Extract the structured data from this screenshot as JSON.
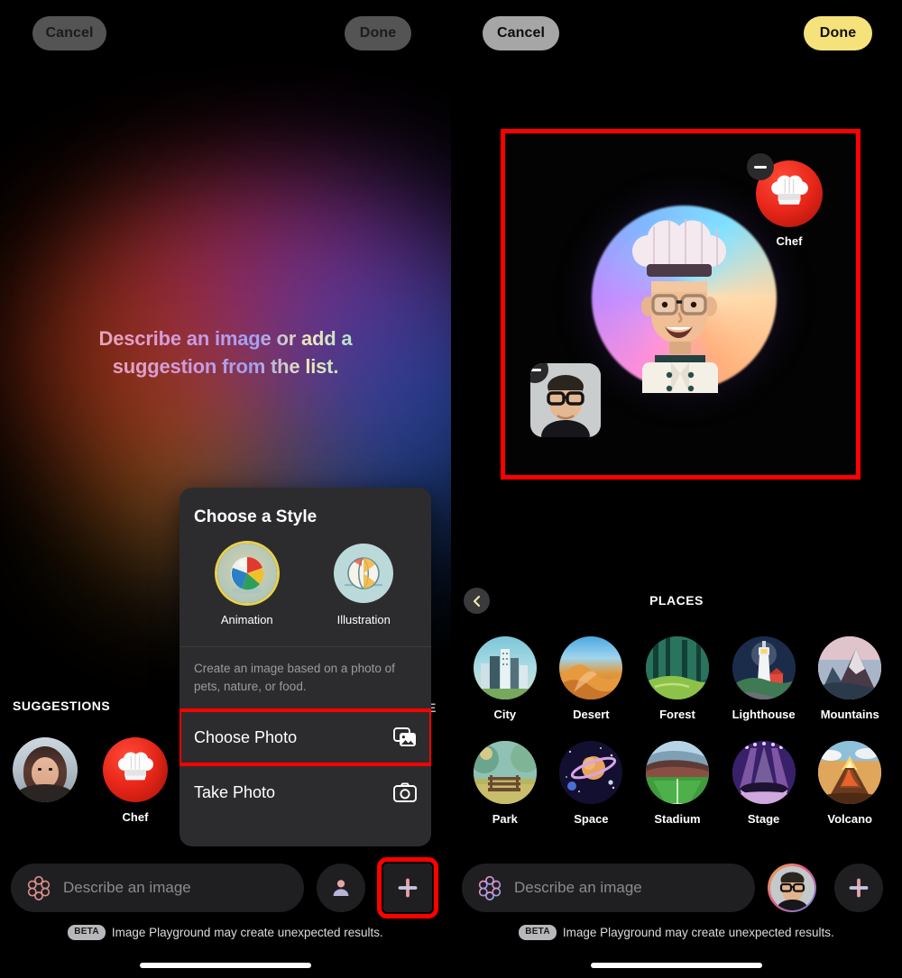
{
  "left_panel": {
    "top_bar": {
      "cancel_label": "Cancel",
      "done_label": "Done"
    },
    "headline": "Describe an image or add a suggestion from the list.",
    "suggestions": {
      "header": "SUGGESTIONS",
      "items": [
        {
          "label": "",
          "icon": "photo-avatar-woman"
        },
        {
          "label": "Chef",
          "icon": "chef-hat-icon"
        }
      ]
    },
    "partial_header_behind_sheet": "E",
    "style_sheet": {
      "title": "Choose a Style",
      "styles": [
        {
          "label": "Animation",
          "icon": "beach-ball-animation-icon",
          "selected": true
        },
        {
          "label": "Illustration",
          "icon": "beach-ball-illustration-icon",
          "selected": false
        }
      ],
      "description": "Create an image based on a photo of pets, nature, or food.",
      "actions": [
        {
          "label": "Choose Photo",
          "icon": "photos-stack-icon",
          "highlighted": true
        },
        {
          "label": "Take Photo",
          "icon": "camera-icon",
          "highlighted": false
        }
      ]
    },
    "bottom_bar": {
      "input_placeholder": "Describe an image",
      "input_value": "",
      "person_button_icon": "person-icon",
      "add_button_icon": "plus-icon",
      "add_button_highlighted": true,
      "beta_badge": "BETA",
      "disclaimer": "Image Playground may create unexpected results."
    }
  },
  "right_panel": {
    "top_bar": {
      "cancel_label": "Cancel",
      "done_label": "Done"
    },
    "preview": {
      "highlighted": true,
      "generated_image_alt": "chef caricature portrait",
      "chips": [
        {
          "label": "Chef",
          "icon": "chef-hat-icon",
          "remove_icon": "minus-icon"
        },
        {
          "label": "",
          "icon": "person-photo",
          "remove_icon": "minus-icon"
        }
      ]
    },
    "places": {
      "back_icon": "chevron-left-icon",
      "header": "PLACES",
      "items": [
        {
          "label": "City",
          "art": "p-city"
        },
        {
          "label": "Desert",
          "art": "p-desert"
        },
        {
          "label": "Forest",
          "art": "p-forest"
        },
        {
          "label": "Lighthouse",
          "art": "p-light"
        },
        {
          "label": "Mountains",
          "art": "p-mount"
        },
        {
          "label": "Park",
          "art": "p-park"
        },
        {
          "label": "Space",
          "art": "p-space"
        },
        {
          "label": "Stadium",
          "art": "p-stadium"
        },
        {
          "label": "Stage",
          "art": "p-stage"
        },
        {
          "label": "Volcano",
          "art": "p-volc"
        }
      ]
    },
    "bottom_bar": {
      "input_placeholder": "Describe an image",
      "input_value": "",
      "avatar_icon": "user-photo-avatar",
      "add_button_icon": "plus-icon",
      "beta_badge": "BETA",
      "disclaimer": "Image Playground may create unexpected results."
    }
  },
  "colors": {
    "accent_yellow": "#f6e27a",
    "highlight_red": "#ff0000",
    "sheet_bg": "#2c2c2e",
    "page_bg": "#000000",
    "pill_inactive": "#545454",
    "pill_active": "#a6a6a6"
  }
}
